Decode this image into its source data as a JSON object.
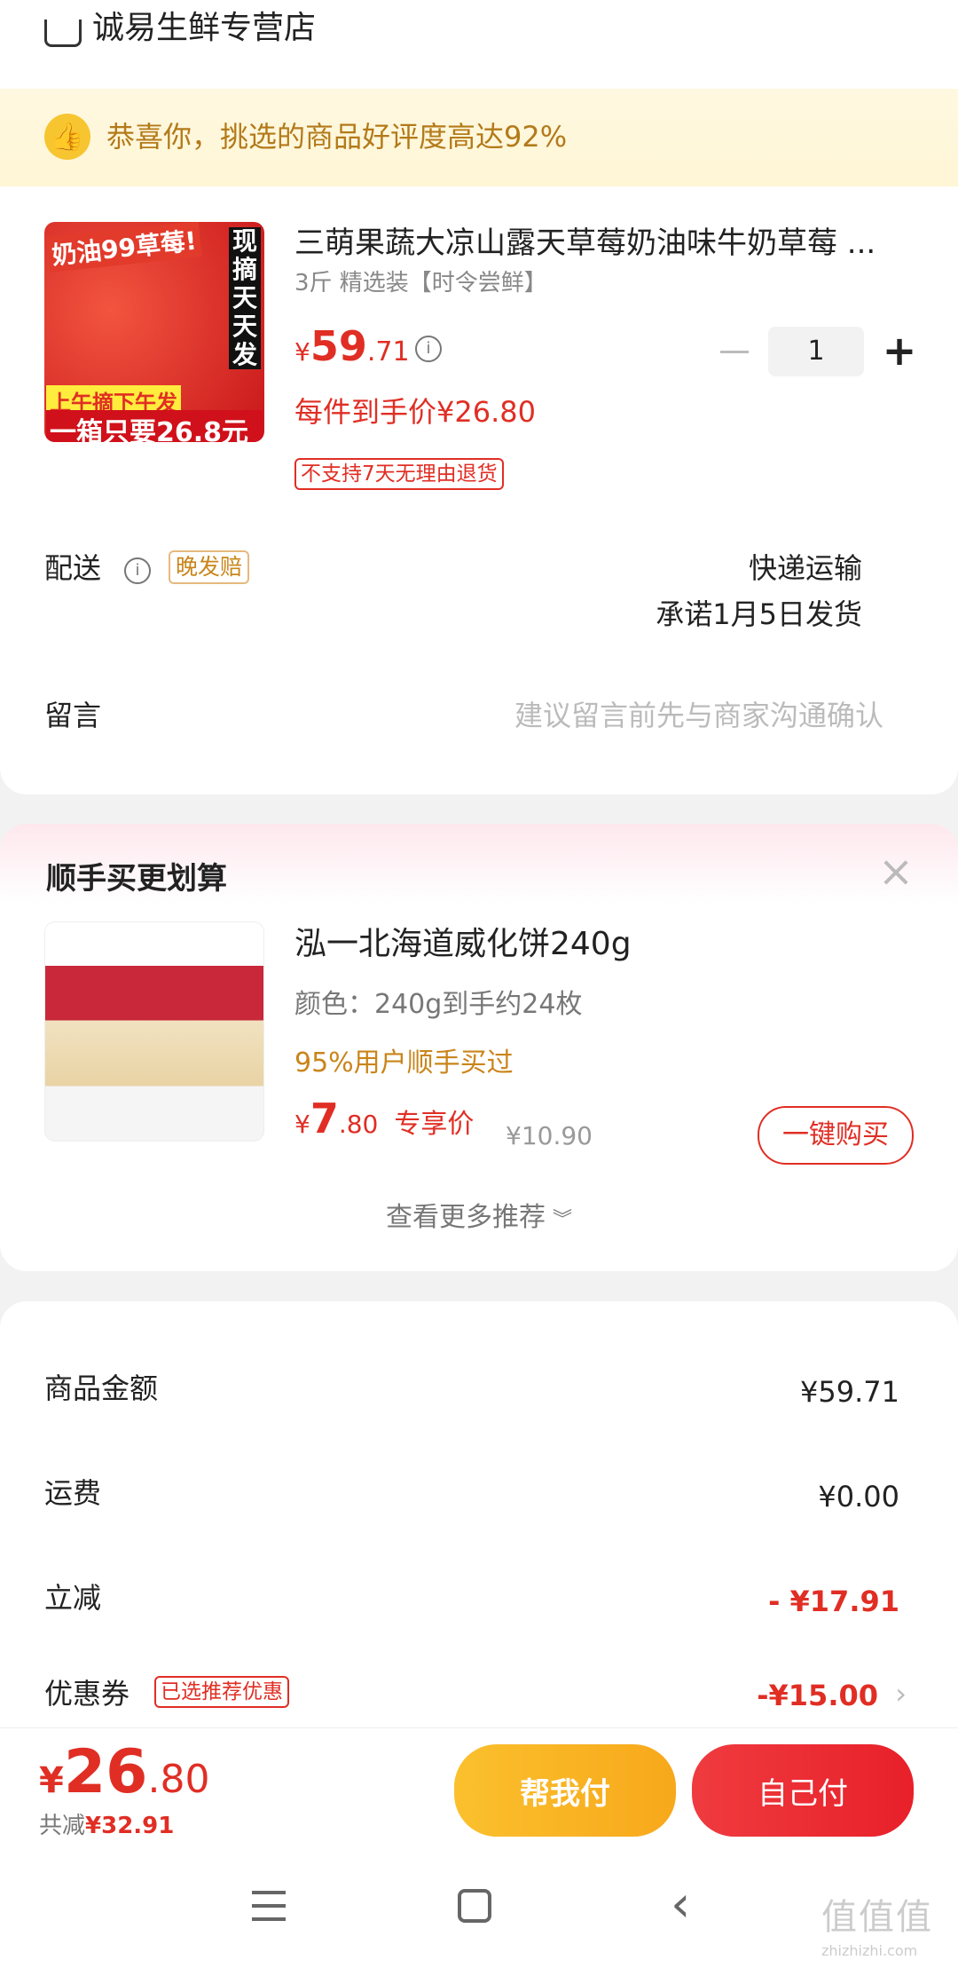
{
  "store": {
    "name": "诚易生鲜专营店"
  },
  "banner": {
    "text": "恭喜你，挑选的商品好评度高达92%"
  },
  "product": {
    "image_text_top": "奶油99草莓!",
    "image_text_side": "现摘天天发",
    "image_text_bottom1": "上午摘下午发",
    "image_text_bottom2": "一箱只要26.8元",
    "title": "三萌果蔬大凉山露天草莓奶油味牛奶草莓 ...",
    "spec": "3斤 精选装【时令尝鲜】",
    "price_symbol": "¥",
    "price_int": "59",
    "price_dec": ".71",
    "unit_price": "每件到手价¥26.80",
    "quantity": "1",
    "no_return_tag": "不支持7天无理由退货"
  },
  "delivery": {
    "label": "配送",
    "badge": "晚发赔",
    "method": "快递运输",
    "promise": "承诺1月5日发货"
  },
  "message": {
    "label": "留言",
    "placeholder": "建议留言前先与商家沟通确认"
  },
  "upsell": {
    "title": "顺手买更划算",
    "item_name": "泓一北海道威化饼240g",
    "item_spec": "颜色：240g到手约24枚",
    "item_social": "95%用户顺手买过",
    "price_symbol": "¥",
    "price_int": "7",
    "price_dec": ".80",
    "price_label": "专享价",
    "original_price": "¥10.90",
    "buy_button": "一键购买",
    "more": "查看更多推荐"
  },
  "summary": {
    "rows": [
      {
        "label": "商品金额",
        "value": "¥59.71"
      },
      {
        "label": "运费",
        "value": "¥0.00"
      },
      {
        "label": "立减",
        "value": "- ¥17.91"
      },
      {
        "label": "优惠券",
        "tag": "已选推荐优惠",
        "value": "-¥15.00"
      }
    ]
  },
  "bottom_bar": {
    "total_symbol": "¥",
    "total_int": "26",
    "total_dec": ".80",
    "saved_label": "共减",
    "saved_value": "¥32.91",
    "help_pay": "帮我付",
    "self_pay": "自己付"
  },
  "watermark": {
    "text": "值值值",
    "url": "zhizhizhi.com"
  },
  "colors": {
    "accent": "#e02e24",
    "gold": "#fbc02d",
    "orange_text": "#c9851a"
  }
}
